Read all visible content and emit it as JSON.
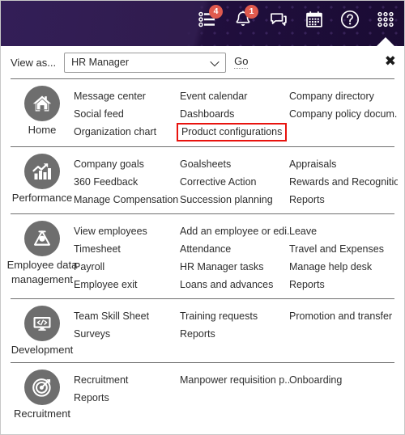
{
  "header": {
    "icons": [
      {
        "name": "tasks-icon",
        "badge": "4"
      },
      {
        "name": "notification-bell-icon",
        "badge": "1"
      },
      {
        "name": "chat-icon",
        "badge": ""
      },
      {
        "name": "calendar-icon",
        "badge": ""
      },
      {
        "name": "help-icon",
        "badge": ""
      },
      {
        "name": "app-grid-icon",
        "badge": ""
      }
    ],
    "collapse_caret": "collapse-caret-icon",
    "background_color": "#231044",
    "badge_color": "#e05a4e"
  },
  "viewas": {
    "label": "View as...",
    "selected": "HR Manager",
    "placeholder": "Select role",
    "go_label": "Go",
    "close_label": "✖"
  },
  "highlight_color": "#e8130e",
  "sections": [
    {
      "id": "home",
      "title": "Home",
      "icon": "home-icon",
      "columns": [
        [
          {
            "label": "Message center"
          },
          {
            "label": "Social feed"
          },
          {
            "label": "Organization chart"
          }
        ],
        [
          {
            "label": "Event calendar"
          },
          {
            "label": "Dashboards"
          },
          {
            "label": "Product configurations",
            "highlighted": true
          }
        ],
        [
          {
            "label": "Company directory"
          },
          {
            "label": "Company policy docum..."
          }
        ]
      ]
    },
    {
      "id": "performance",
      "title": "Performance",
      "icon": "chart-growth-icon",
      "columns": [
        [
          {
            "label": "Company goals"
          },
          {
            "label": "360 Feedback"
          },
          {
            "label": "Manage Compensation"
          }
        ],
        [
          {
            "label": "Goalsheets"
          },
          {
            "label": "Corrective Action"
          },
          {
            "label": "Succession planning"
          }
        ],
        [
          {
            "label": "Appraisals"
          },
          {
            "label": "Rewards and Recognitio..."
          },
          {
            "label": "Reports"
          }
        ]
      ]
    },
    {
      "id": "employee-data-management",
      "title": "Employee data management",
      "icon": "person-triangle-icon",
      "columns": [
        [
          {
            "label": "View employees"
          },
          {
            "label": "Timesheet"
          },
          {
            "label": "Payroll"
          },
          {
            "label": "Employee exit"
          }
        ],
        [
          {
            "label": "Add an employee or edi..."
          },
          {
            "label": "Attendance"
          },
          {
            "label": "HR Manager tasks"
          },
          {
            "label": "Loans and advances"
          }
        ],
        [
          {
            "label": "Leave"
          },
          {
            "label": "Travel and Expenses"
          },
          {
            "label": "Manage help desk"
          },
          {
            "label": "Reports"
          }
        ]
      ]
    },
    {
      "id": "development",
      "title": "Development",
      "icon": "monitor-code-icon",
      "columns": [
        [
          {
            "label": "Team Skill Sheet"
          },
          {
            "label": "Surveys"
          }
        ],
        [
          {
            "label": "Training requests"
          },
          {
            "label": "Reports"
          }
        ],
        [
          {
            "label": "Promotion and transfer"
          }
        ]
      ]
    },
    {
      "id": "recruitment",
      "title": "Recruitment",
      "icon": "target-arrow-icon",
      "columns": [
        [
          {
            "label": "Recruitment"
          },
          {
            "label": "Reports"
          }
        ],
        [
          {
            "label": "Manpower requisition p..."
          }
        ],
        [
          {
            "label": "Onboarding"
          }
        ]
      ]
    }
  ]
}
